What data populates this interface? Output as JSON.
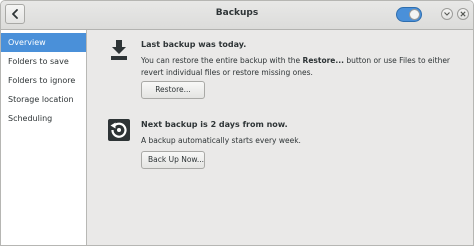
{
  "header": {
    "title": "Backups",
    "switch_on": true,
    "back_icon": "chevron-left-icon",
    "menu_icon": "chevron-down-icon",
    "close_icon": "close-icon"
  },
  "sidebar": {
    "items": [
      {
        "label": "Overview",
        "active": true
      },
      {
        "label": "Folders to save",
        "active": false
      },
      {
        "label": "Folders to ignore",
        "active": false
      },
      {
        "label": "Storage location",
        "active": false
      },
      {
        "label": "Scheduling",
        "active": false
      }
    ]
  },
  "last_backup": {
    "icon": "download-icon",
    "title": "Last backup was today.",
    "text": "You can restore the entire backup with the Restore... button or use Files to either revert individual files or restore missing ones.",
    "button": "Restore..."
  },
  "next_backup": {
    "icon": "clock-restore-icon",
    "title": "Next backup is 2 days from now.",
    "text": "A backup automatically starts every week.",
    "button": "Back Up Now..."
  },
  "colors": {
    "accent": "#4a90d9",
    "window_bg": "#eae9e8",
    "text": "#2e3436"
  }
}
